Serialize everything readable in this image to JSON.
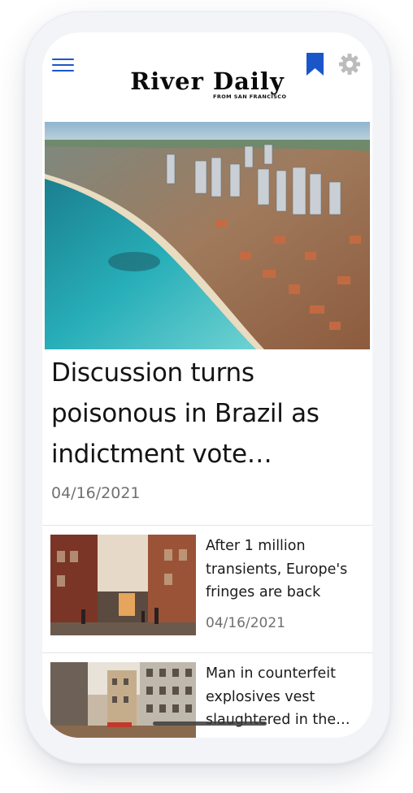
{
  "header": {
    "logo_title": "River Daily",
    "logo_subtitle": "FROM SAN FRANCISCO",
    "menu_icon": "hamburger-menu-icon",
    "bookmark_icon": "bookmark-icon",
    "settings_icon": "gear-icon"
  },
  "hero": {
    "title": "Discussion turns poisonous in Brazil as indictment vote…",
    "date": "04/16/2021"
  },
  "articles": [
    {
      "title": "After 1 million transients, Europe's fringes are back",
      "date": "04/16/2021"
    },
    {
      "title": "Man in counterfeit explosives vest slaughtered in the…"
    }
  ],
  "colors": {
    "accent": "#1a56c8",
    "text": "#141414",
    "muted": "#707070",
    "gear": "#bcbcbc"
  }
}
